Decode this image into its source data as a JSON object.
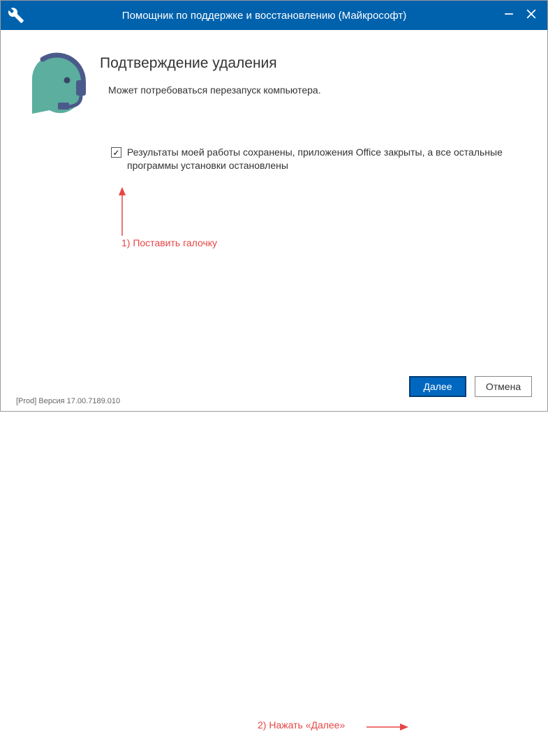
{
  "titlebar": {
    "title": "Помощник по поддержке и восстановлению (Майкрософт)"
  },
  "heading": "Подтверждение удаления",
  "subtext": "Может потребоваться перезапуск компьютера.",
  "checkbox": {
    "checked": true,
    "label": "Результаты моей работы сохранены, приложения Office закрыты, а все остальные программы установки остановлены"
  },
  "annotations": {
    "step1": "1) Поставить галочку",
    "step2": "2) Нажать «Далее»"
  },
  "footer": {
    "version": "[Prod] Версия 17.00.7189.010",
    "next": "Далее",
    "cancel": "Отмена"
  },
  "colors": {
    "titlebar": "#0062ad",
    "primary_btn": "#0067c0",
    "annotation": "#e84545",
    "avatar_face": "#5cae9e",
    "avatar_headset": "#4a5a8a"
  }
}
